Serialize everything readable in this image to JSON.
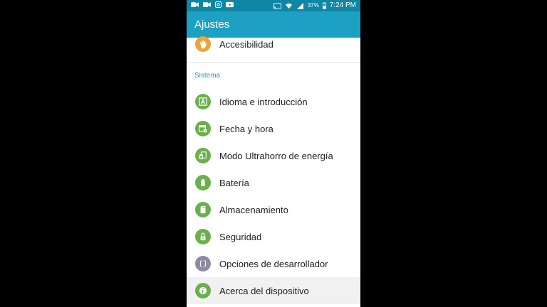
{
  "status_bar": {
    "battery_percent": "37%",
    "time": "7:24 PM",
    "left_icons": [
      "video-icon",
      "video-icon",
      "instagram-icon",
      "youtube-icon"
    ],
    "right_icons": [
      "cast-icon",
      "wifi-icon",
      "signal-icon",
      "battery-icon"
    ]
  },
  "app_bar": {
    "title": "Ajustes"
  },
  "list": {
    "top_item": {
      "label": "Accesibilidad",
      "icon": "hand-icon",
      "color": "#f0a33a"
    },
    "section_title": "Sistema",
    "items": [
      {
        "label": "Idioma e introducción",
        "icon": "language-icon",
        "color": "#6ab04c"
      },
      {
        "label": "Fecha y hora",
        "icon": "calendar-icon",
        "color": "#6ab04c"
      },
      {
        "label": "Modo Ultrahorro de energía",
        "icon": "power-saving-icon",
        "color": "#6ab04c"
      },
      {
        "label": "Batería",
        "icon": "battery-icon",
        "color": "#6ab04c"
      },
      {
        "label": "Almacenamiento",
        "icon": "storage-icon",
        "color": "#6ab04c"
      },
      {
        "label": "Seguridad",
        "icon": "lock-icon",
        "color": "#6ab04c"
      },
      {
        "label": "Opciones de desarrollador",
        "icon": "braces-icon",
        "color": "#8d8aa6"
      },
      {
        "label": "Acerca del dispositivo",
        "icon": "info-icon",
        "color": "#6ab04c"
      }
    ]
  },
  "colors": {
    "status_bar": "#0e86a4",
    "app_bar": "#1ca1c4",
    "section_title": "#1ca1c4",
    "black_background": "#000000"
  }
}
